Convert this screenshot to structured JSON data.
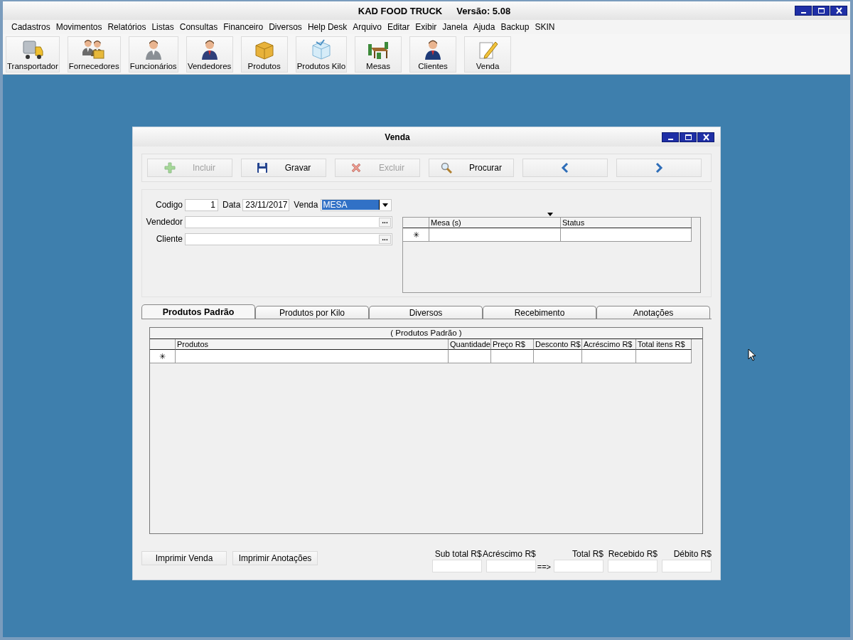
{
  "app": {
    "title": "KAD FOOD TRUCK",
    "version": "Versão: 5.08"
  },
  "menu": [
    "Cadastros",
    "Movimentos",
    "Relatórios",
    "Listas",
    "Consultas",
    "Financeiro",
    "Diversos",
    "Help Desk",
    "Arquivo",
    "Editar",
    "Exibir",
    "Janela",
    "Ajuda",
    "Backup",
    "SKIN"
  ],
  "toolbar": [
    {
      "label": "Transportador"
    },
    {
      "label": "Fornecedores"
    },
    {
      "label": "Funcionários"
    },
    {
      "label": "Vendedores"
    },
    {
      "label": "Produtos"
    },
    {
      "label": "Produtos Kilo"
    },
    {
      "label": "Mesas"
    },
    {
      "label": "Clientes"
    },
    {
      "label": "Venda"
    }
  ],
  "child_window": {
    "title": "Venda",
    "actions": [
      {
        "label": "Incluir",
        "disabled": true
      },
      {
        "label": "Gravar",
        "disabled": false
      },
      {
        "label": "Excluir",
        "disabled": true
      },
      {
        "label": "Procurar",
        "disabled": false
      },
      {
        "disabled": false
      },
      {
        "disabled": false
      }
    ],
    "form": {
      "codigo": {
        "label": "Codigo",
        "value": "1"
      },
      "data": {
        "label": "Data",
        "value": "23/11/2017"
      },
      "venda": {
        "label": "Venda",
        "value": "MESA",
        "text_selected": true
      },
      "vendedor": {
        "label": "Vendedor",
        "button": "..."
      },
      "cliente": {
        "label": "Cliente",
        "button": "..."
      }
    },
    "mesa_grid": {
      "columns": [
        "Mesa (s)",
        "Status"
      ],
      "new_row_marker": "✳"
    },
    "tabs": [
      {
        "label": "Produtos Padrão",
        "selected": true
      },
      {
        "label": "Produtos por Kilo",
        "selected": false
      },
      {
        "label": "Diversos",
        "selected": false
      },
      {
        "label": "Recebimento",
        "selected": false
      },
      {
        "label": "Anotações",
        "selected": false
      }
    ],
    "products_grid": {
      "caption": "( Produtos Padrão )",
      "columns": [
        "Produtos",
        "Quantidade",
        "Preço R$",
        "Desconto R$",
        "Acréscimo R$",
        "Total itens R$"
      ],
      "new_row_marker": "✳"
    },
    "print_buttons": [
      "Imprimir Venda",
      "Imprimir Anotações"
    ],
    "totals": [
      {
        "kind": "field",
        "label": "Sub total R$"
      },
      {
        "kind": "field",
        "label": "Acréscimo R$"
      },
      {
        "kind": "arrow",
        "text": "==>"
      },
      {
        "kind": "field",
        "label": "Total R$"
      },
      {
        "kind": "field",
        "label": "Recebido R$"
      },
      {
        "kind": "field",
        "label": "Débito R$"
      }
    ]
  }
}
